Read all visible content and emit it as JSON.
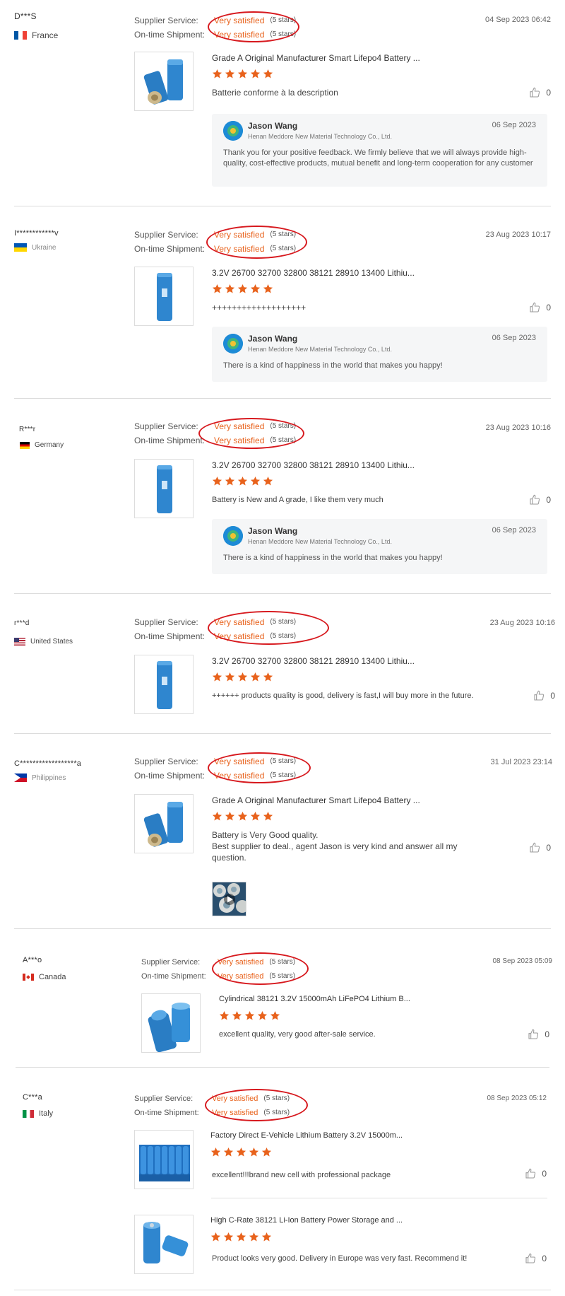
{
  "labels": {
    "supplier_service": "Supplier Service:",
    "on_time_shipment": "On-time Shipment:",
    "rating_value": "Very satisfied",
    "rating_stars": "(5 stars)"
  },
  "colors": {
    "accent": "#e8621c",
    "annotation": "#d7191e",
    "star": "#e8621c"
  },
  "reviews": [
    {
      "buyer": "D***S",
      "country": "France",
      "date": "04 Sep 2023 06:42",
      "product_title": "Grade A Original Manufacturer Smart Lifepo4 Battery ...",
      "comment": "Batterie conforme à la description",
      "likes": "0",
      "reply": {
        "name": "Jason Wang",
        "company": "Henan Meddore New Material Technology Co., Ltd.",
        "date": "06 Sep 2023",
        "text": "Thank you for your positive feedback. We firmly believe that we will always provide high-quality, cost-effective products, mutual benefit and long-term cooperation for any customer"
      }
    },
    {
      "buyer": "I************v",
      "country": "Ukraine",
      "date": "23 Aug 2023 10:17",
      "product_title": "3.2V 26700 32700 32800 38121 28910 13400 Lithiu...",
      "comment": "+++++++++++++++++++",
      "likes": "0",
      "reply": {
        "name": "Jason Wang",
        "company": "Henan Meddore New Material Technology Co., Ltd.",
        "date": "06 Sep 2023",
        "text": "There is a kind of happiness in the world that makes you happy!"
      }
    },
    {
      "buyer": "R***r",
      "country": "Germany",
      "date": "23 Aug 2023 10:16",
      "product_title": "3.2V 26700 32700 32800 38121 28910 13400 Lithiu...",
      "comment": "Battery is New and A grade, I like them very much",
      "likes": "0",
      "reply": {
        "name": "Jason Wang",
        "company": "Henan Meddore New Material Technology Co., Ltd.",
        "date": "06 Sep 2023",
        "text": "There is a kind of happiness in the world that makes you happy!"
      }
    },
    {
      "buyer": "r***d",
      "country": "United States",
      "date": "23 Aug 2023 10:16",
      "product_title": "3.2V 26700 32700 32800 38121 28910 13400 Lithiu...",
      "comment": "++++++ products quality is good, delivery is fast,I will buy more in the future.",
      "likes": "0"
    },
    {
      "buyer": "C******************a",
      "country": "Philippines",
      "date": "31 Jul 2023 23:14",
      "product_title": "Grade A Original Manufacturer Smart Lifepo4 Battery ...",
      "comment": "Battery is Very Good quality.\nBest supplier to deal., agent Jason is very kind and answer all my question.",
      "likes": "0"
    },
    {
      "buyer": "A***o",
      "country": "Canada",
      "date": "08 Sep 2023 05:09",
      "product_title": "Cylindrical 38121 3.2V 15000mAh LiFePO4 Lithium B...",
      "comment": "excellent quality, very good after-sale service.",
      "likes": "0"
    },
    {
      "buyer": "C***a",
      "country": "Italy",
      "date": "08 Sep 2023 05:12",
      "product_title": "Factory Direct E-Vehicle Lithium Battery 3.2V 15000m...",
      "comment": "excellent!!!brand new cell with professional package",
      "likes": "0",
      "product2_title": "High C-Rate 38121 Li-Ion Battery Power Storage and ...",
      "product2_comment": "Product looks very good. Delivery in Europe was very fast. Recommend it!",
      "product2_likes": "0"
    }
  ]
}
